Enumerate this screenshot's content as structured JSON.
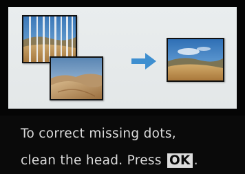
{
  "message": {
    "line1": "To correct missing dots,",
    "line2_prefix": "clean the head. Press",
    "ok_key": "OK",
    "line2_suffix": "."
  },
  "illustration": {
    "before_image": "banded-landscape-photo",
    "sample_image": "desert-dunes-photo",
    "after_image": "clean-landscape-photo",
    "arrow_icon": "arrow-right-icon",
    "arrow_color": "#3e8fd0"
  },
  "colors": {
    "background": "#0a0a0a",
    "text": "#dcdcdc",
    "illustration_background": "#e6eaeb"
  }
}
